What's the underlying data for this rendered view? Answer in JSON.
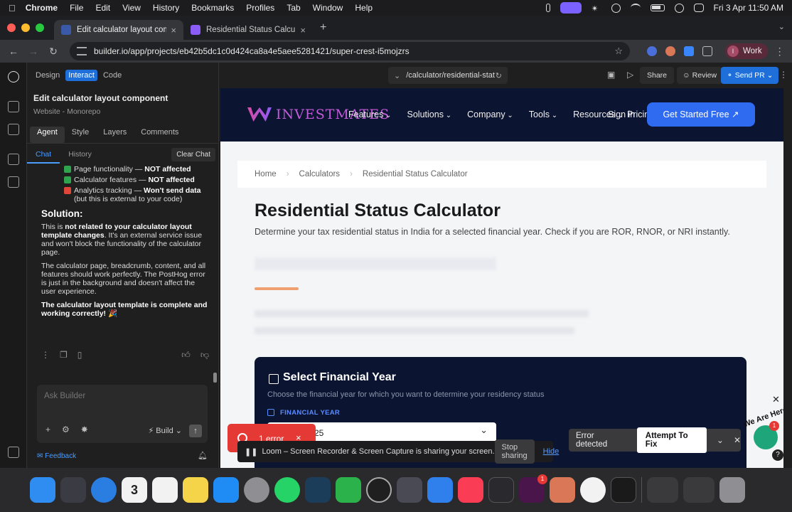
{
  "menubar": {
    "app": "Chrome",
    "items": [
      "File",
      "Edit",
      "View",
      "History",
      "Bookmarks",
      "Profiles",
      "Tab",
      "Window",
      "Help"
    ],
    "clock": "Fri 3 Apr  11:50 AM"
  },
  "tabs": [
    {
      "title": "Edit calculator layout compon",
      "active": true,
      "favicon_color": "#3a5aa8"
    },
    {
      "title": "Residential Status Calculator",
      "active": false,
      "favicon_color": "#8b5cf6"
    }
  ],
  "address": {
    "url": "builder.io/app/projects/eb42b5dc1c0d424ca8a4e5aee5281421/super-crest-i5mojzrs"
  },
  "profile": {
    "initial": "I",
    "label": "Work"
  },
  "builder": {
    "modes": [
      "Design",
      "Interact",
      "Code"
    ],
    "active_mode": "Interact",
    "component_title": "Edit calculator layout component",
    "component_subtitle": "Website - Monorepo",
    "panel_tabs": [
      "Agent",
      "Style",
      "Layers",
      "Comments"
    ],
    "sub_tabs": [
      "Chat",
      "History"
    ],
    "clear_chat": "Clear Chat",
    "chat": {
      "items": [
        {
          "lead": "Page functionality — ",
          "bold": "NOT affected",
          "rest": "",
          "ok": true
        },
        {
          "lead": "Calculator features — ",
          "bold": "NOT affected",
          "rest": "",
          "ok": true
        },
        {
          "lead": "Analytics tracking — ",
          "bold": "Won't send data",
          "rest": " (but this is external to your code)",
          "ok": false
        }
      ],
      "solution_heading": "Solution:",
      "p1_pre": "This is ",
      "p1_bold": "not related to your calculator layout template changes",
      "p1_post": ". It's an external service issue and won't block the functionality of the calculator page.",
      "p2": "The calculator page, breadcrumb, content, and all features should work perfectly. The PostHog error is just in the background and doesn't affect the user experience.",
      "p3_bold": "The calculator layout template is complete and working correctly! 🎉"
    },
    "ask_placeholder": "Ask Builder",
    "build_label": "Build",
    "feedback": "Feedback",
    "route": "/calculator/residential-stat",
    "share": "Share",
    "review": "Review",
    "send_pr": "Send PR"
  },
  "site": {
    "brand": "INVESTMATES",
    "nav": [
      "Features",
      "Solutions",
      "Company",
      "Tools",
      "Resources"
    ],
    "sign_in": "Sign in",
    "pricing": "Pricing",
    "cta": "Get Started Free",
    "breadcrumb": [
      "Home",
      "Calculators",
      "Residential Status Calculator"
    ],
    "title": "Residential Status Calculator",
    "lede": "Determine your tax residential status in India for a selected financial year. Check if you are ROR, RNOR, or NRI instantly.",
    "card": {
      "heading": "Select Financial Year",
      "sub": "Choose the financial year for which you want to determine your residency status",
      "field_label": "FINANCIAL YEAR",
      "field_value": "25"
    },
    "widget_text": "We Are Here!",
    "widget_badge": "1"
  },
  "overlays": {
    "error_pill": "1 error",
    "loom_message": "Loom – Screen Recorder & Screen Capture is sharing your screen.",
    "stop_sharing": "Stop sharing",
    "hide": "Hide",
    "error_detected": "Error detected",
    "attempt_fix": "Attempt To Fix"
  },
  "dock": {
    "calendar_day": "3",
    "apps": [
      {
        "name": "finder",
        "color": "#2f8cf0"
      },
      {
        "name": "launchpad",
        "color": "#3b3b44"
      },
      {
        "name": "safari",
        "color": "#2a7de1"
      },
      {
        "name": "calendar",
        "color": "#f2f2f2"
      },
      {
        "name": "reminders",
        "color": "#f2f2f2"
      },
      {
        "name": "notes",
        "color": "#f6d44a"
      },
      {
        "name": "app-store",
        "color": "#1f8cf5"
      },
      {
        "name": "system-settings",
        "color": "#8e8e93"
      },
      {
        "name": "whatsapp",
        "color": "#25d366"
      },
      {
        "name": "pinwheel",
        "color": "#1c3d5a"
      },
      {
        "name": "numbers",
        "color": "#2cb24a"
      },
      {
        "name": "chatgpt",
        "color": "#1f1f1f"
      },
      {
        "name": "db-tool",
        "color": "#4a4a55"
      },
      {
        "name": "keys",
        "color": "#2f80ed"
      },
      {
        "name": "music",
        "color": "#fa3c55"
      },
      {
        "name": "grid-app",
        "color": "#2a2a2e"
      },
      {
        "name": "slack",
        "color": "#4a154b"
      },
      {
        "name": "claude",
        "color": "#d97757"
      },
      {
        "name": "chrome",
        "color": "#f2f2f2"
      },
      {
        "name": "terminal",
        "color": "#1a1a1a"
      }
    ],
    "slack_badge": "1"
  }
}
